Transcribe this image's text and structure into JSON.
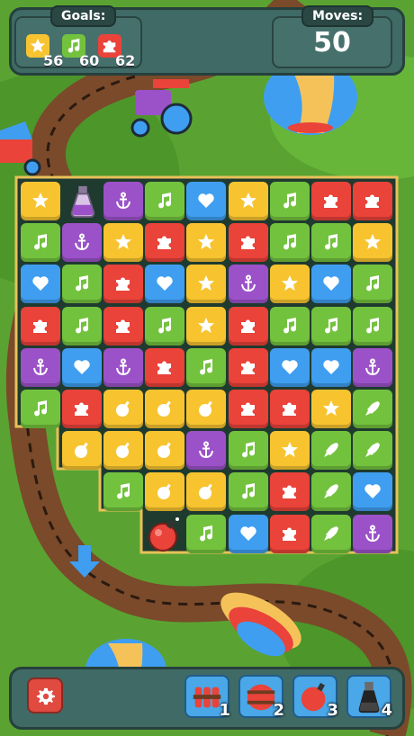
{
  "hud": {
    "goals_label": "Goals:",
    "moves_label": "Moves:",
    "moves_value": "50",
    "goals": [
      {
        "icon": "star-icon",
        "color": "#f7c430",
        "count": "56"
      },
      {
        "icon": "music-note-icon",
        "color": "#73c23e",
        "count": "60"
      },
      {
        "icon": "puzzle-icon",
        "color": "#e9433a",
        "count": "62"
      }
    ]
  },
  "colors": {
    "yellow": "#f7c430",
    "green": "#73c23e",
    "red": "#e9433a",
    "blue": "#3f9ef0",
    "purple": "#9b52c8",
    "board_bg": "#1f3a2f",
    "board_border": "#e8c15a",
    "panel": "#3f6a66"
  },
  "board": {
    "rows": [
      [
        "star-yellow",
        "potion",
        "anchor-purple",
        "music-green",
        "heart-blue",
        "star-yellow",
        "music-green",
        "puzzle-red",
        "puzzle-red"
      ],
      [
        "music-green",
        "anchor-purple",
        "star-yellow",
        "puzzle-red",
        "star-yellow",
        "puzzle-red",
        "music-green",
        "music-green",
        "star-yellow"
      ],
      [
        "heart-blue",
        "music-green",
        "puzzle-red",
        "heart-blue",
        "star-yellow",
        "anchor-purple",
        "star-yellow",
        "heart-blue",
        "music-green"
      ],
      [
        "puzzle-red",
        "music-green",
        "puzzle-red",
        "music-green",
        "star-yellow",
        "puzzle-red",
        "music-green",
        "music-green",
        "music-green"
      ],
      [
        "anchor-purple",
        "heart-blue",
        "anchor-purple",
        "puzzle-red",
        "music-green",
        "puzzle-red",
        "heart-blue",
        "heart-blue",
        "anchor-purple"
      ],
      [
        "music-green",
        "puzzle-red",
        "bomb-yellow",
        "bomb-yellow",
        "bomb-yellow",
        "puzzle-red",
        "puzzle-red",
        "star-yellow",
        "rocket-green"
      ],
      [
        null,
        "bomb-yellow",
        "bomb-yellow",
        "bomb-yellow",
        "anchor-purple",
        "music-green",
        "star-yellow",
        "rocket-green",
        "rocket-green"
      ],
      [
        null,
        null,
        "music-green",
        "bomb-yellow",
        "bomb-yellow",
        "music-green",
        "puzzle-red",
        "rocket-green",
        "heart-blue"
      ],
      [
        null,
        null,
        null,
        "bomb-red",
        "music-green",
        "heart-blue",
        "puzzle-red",
        "rocket-green",
        "anchor-purple"
      ]
    ]
  },
  "boosters": [
    {
      "icon": "dynamite-icon",
      "count": "1"
    },
    {
      "icon": "barrel-icon",
      "count": "2"
    },
    {
      "icon": "bomb-icon",
      "count": "3"
    },
    {
      "icon": "potion-icon",
      "count": "4"
    }
  ],
  "hint": {
    "icon": "arrow-down-icon",
    "color": "#3f9ef0"
  }
}
